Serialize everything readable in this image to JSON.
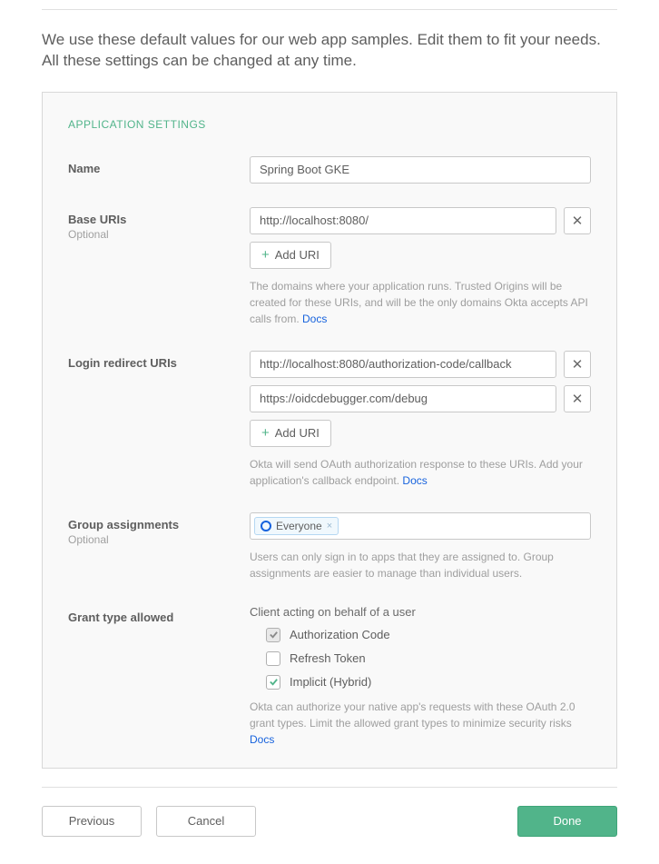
{
  "intro": "We use these default values for our web app samples. Edit them to fit your needs. All these settings can be changed at any time.",
  "section_title": "APPLICATION SETTINGS",
  "fields": {
    "name": {
      "label": "Name",
      "value": "Spring Boot GKE"
    },
    "base_uris": {
      "label": "Base URIs",
      "sublabel": "Optional",
      "values": [
        "http://localhost:8080/"
      ],
      "add_label": "Add URI",
      "help": "The domains where your application runs. Trusted Origins will be created for these URIs, and will be the only domains Okta accepts API calls from. ",
      "docs_label": "Docs"
    },
    "login_redirect_uris": {
      "label": "Login redirect URIs",
      "values": [
        "http://localhost:8080/authorization-code/callback",
        "https://oidcdebugger.com/debug"
      ],
      "add_label": "Add URI",
      "help": "Okta will send OAuth authorization response to these URIs. Add your application's callback endpoint. ",
      "docs_label": "Docs"
    },
    "group_assignments": {
      "label": "Group assignments",
      "sublabel": "Optional",
      "chip": "Everyone",
      "help": "Users can only sign in to apps that they are assigned to. Group assignments are easier to manage than individual users."
    },
    "grant_type": {
      "label": "Grant type allowed",
      "subtitle": "Client acting on behalf of a user",
      "options": [
        {
          "label": "Authorization Code",
          "checked": true,
          "disabled": true
        },
        {
          "label": "Refresh Token",
          "checked": false,
          "disabled": false
        },
        {
          "label": "Implicit (Hybrid)",
          "checked": true,
          "disabled": false
        }
      ],
      "help": "Okta can authorize your native app's requests with these OAuth 2.0 grant types. Limit the allowed grant types to minimize security risks ",
      "docs_label": "Docs"
    }
  },
  "footer": {
    "previous": "Previous",
    "cancel": "Cancel",
    "done": "Done"
  }
}
